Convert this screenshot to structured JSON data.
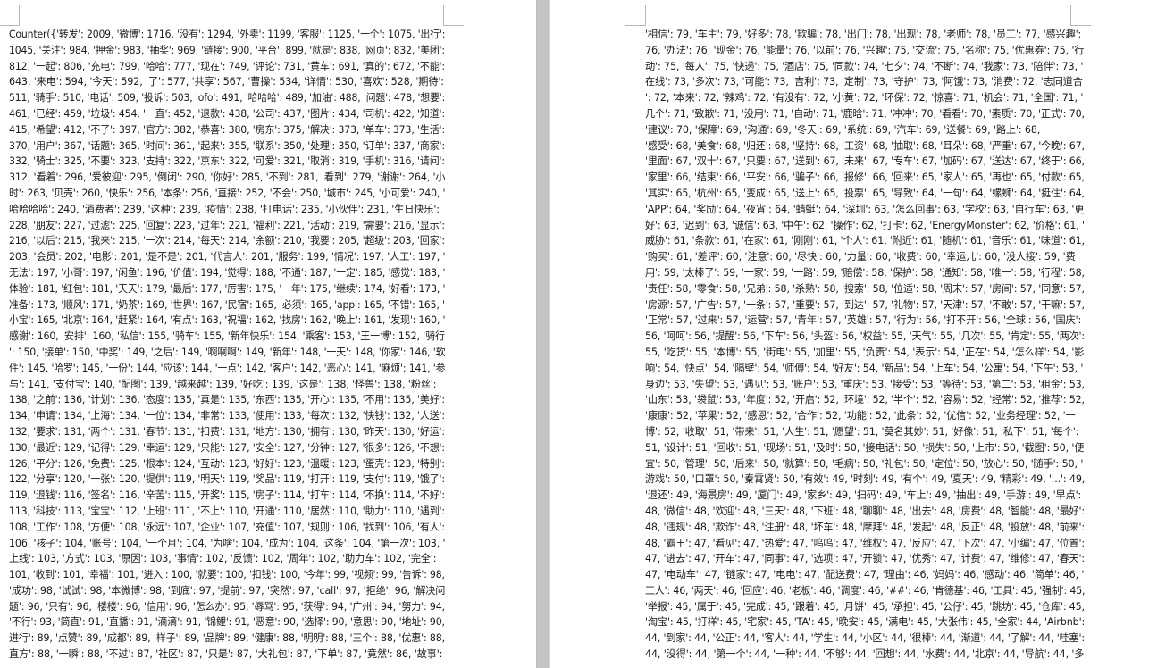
{
  "pages": {
    "left": {
      "lines": [
        "Counter({'转发': 2009, '微博': 1716, '没有': 1294, '外卖': 1199, '客服': 1125, '一个': 1075, '出行':",
        "1045, '关注': 984, '押金': 983, '抽奖': 969, '链接': 900, '平台': 899, '就是': 838, '网页': 832, '美团':",
        "812, '一起': 806, '充电': 799, '哈哈': 777, '现在': 749, '评论': 731, '黄车': 691, '真的': 672, '不能':",
        "643, '来电': 594, '今天': 592, '了': 577, '共享': 567, '曹操': 534, '详情': 530, '喜欢': 528, '期待':",
        "511, '骑手': 510, '电话': 509, '投诉': 503, 'ofo': 491, '哈哈哈': 489, '加油': 488, '问题': 478, '想要':",
        "461, '已经': 459, '垃圾': 454, '一直': 452, '退款': 438, '公司': 437, '图片': 434, '司机': 422, '知道':",
        "415, '希望': 412, '不了': 397, '官方': 382, '恭喜': 380, '房东': 375, '解决': 373, '单车': 373, '生活':",
        "370, '用户': 367, '话题': 365, '时间': 361, '起来': 355, '联系': 350, '处理': 350, '订单': 337, '商家':",
        "332, '骑士': 325, '不要': 323, '支持': 322, '京东': 322, '可爱': 321, '取消': 319, '手机': 316, '请问':",
        "312, '看着': 296, '爱彼迎': 295, '倒闭': 290, '你好': 285, '不到': 281, '看到': 279, '谢谢': 264, '小",
        "时': 263, '贝壳': 260, '快乐': 256, '本条': 256, '直接': 252, '不会': 250, '城市': 245, '小可爱': 240, '",
        "哈哈哈哈': 240, '消费者': 239, '这种': 239, '疫情': 238, '打电话': 235, '小伙伴': 231, '生日快乐':",
        "228, '朋友': 227, '过滤': 225, '回复': 223, '过年': 221, '福利': 221, '活动': 219, '需要': 216, '显示':",
        "216, '以后': 215, '我来': 215, '一次': 214, '每天': 214, '余额': 210, '我要': 205, '超级': 203, '回家':",
        "203, '会员': 202, '电影': 201, '是不是': 201, '代言人': 201, '服务': 199, '情况': 197, '人工': 197, '",
        "无法': 197, '小哥': 197, '闲鱼': 196, '价值': 194, '觉得': 188, '不通': 187, '一定': 185, '感觉': 183, '",
        "体验': 181, '红包': 181, '天天': 179, '最后': 177, '厉害': 175, '一年': 175, '继续': 174, '好看': 173, '",
        "准备': 173, '顺风': 171, '奶茶': 169, '世界': 167, '民宿': 165, '必须': 165, 'app': 165, '不错': 165, '",
        "小宝': 165, '北京': 164, '赶紧': 164, '有点': 163, '祝福': 162, '找房': 162, '晚上': 161, '发现': 160, '",
        "感谢': 160, '安排': 160, '私信': 155, '骑车': 155, '新年快乐': 154, '乘客': 153, '王一博': 152, '骑行",
        "': 150, '接单': 150, '中奖': 149, '之后': 149, '啊啊啊': 149, '新年': 148, '一天': 148, '你家': 146, '软",
        "件': 145, '哈罗': 145, '一份': 144, '应该': 144, '一点': 142, '客户': 142, '恶心': 141, '麻烦': 141, '参",
        "与': 141, '支付宝': 140, '配图': 139, '越来越': 139, '好吃': 139, '这是': 138, '怪兽': 138, '粉丝':",
        "138, '之前': 136, '计划': 136, '态度': 135, '真是': 135, '东西': 135, '开心': 135, '不用': 135, '美好':",
        "134, '申请': 134, '上海': 134, '一位': 134, '非常': 133, '使用': 133, '每次': 132, '快钱': 132, '人送':",
        "132, '要求': 131, '两个': 131, '春节': 131, '扣费': 131, '地方': 130, '拥有': 130, '昨天': 130, '好运':",
        "130, '最近': 129, '记得': 129, '幸运': 129, '只能': 127, '安全': 127, '分钟': 127, '很多': 126, '不想':",
        "126, '平分': 126, '免费': 125, '根本': 124, '互动': 123, '好好': 123, '温暖': 123, '蛋壳': 123, '特别':",
        "122, '分享': 120, '一张': 120, '提供': 119, '明天': 119, '奖品': 119, '打开': 119, '支付': 119, '饿了':",
        "119, '退钱': 116, '签名': 116, '辛苦': 115, '开奖': 115, '房子': 114, '打车': 114, '不换': 114, '不好':",
        "113, '科技': 113, '宝宝': 112, '上班': 111, '不上': 110, '开通': 110, '居然': 110, '助力': 110, '遇到':",
        "108, '工作': 108, '方便': 108, '永远': 107, '企业': 107, '充值': 107, '规则': 106, '找到': 106, '有人':",
        "106, '孩子': 104, '账号': 104, '一个月': 104, '为啥': 104, '成为': 104, '这条': 104, '第一次': 103, '",
        "上线': 103, '方式': 103, '原因': 103, '事情': 102, '反馈': 102, '周年': 102, '助力车': 102, '完全':",
        "101, '收到': 101, '幸福': 101, '进入': 100, '就要': 100, '扣钱': 100, '今年': 99, '视频': 99, '告诉': 98,",
        "'成功': 98, '试试': 98, '本微博': 98, '到底': 97, '提前': 97, '突然': 97, 'call': 97, '拒绝': 96, '解决问",
        "题': 96, '只有': 96, '楼楼': 96, '信用': 96, '怎么办': 95, '辱骂': 95, '获得': 94, '广州': 94, '努力': 94,",
        "'不行': 93, '简直': 91, '直播': 91, '滴滴': 91, '锦鲤': 91, '恶意': 90, '选择': 90, '意思': 90, '地址': 90,",
        "进行': 89, '点赞': 89, '成都': 89, '样子': 89, '品牌': 89, '健康': 88, '明明': 88, '三个': 88, '优惠': 88,",
        "直方': 88, '一瞬': 88, '不过': 87, '社区': 87, '只是': 87, '大礼包': 87, '下单': 87, '竟然': 86, '故事':"
      ]
    },
    "right": {
      "lines": [
        "'相信': 79, '车主': 79, '好多': 78, '欺骗': 78, '出门': 78, '出现': 78, '老师': 78, '员工': 77, '感兴趣':",
        "76, '办法': 76, '现金': 76, '能量': 76, '以前': 76, '兴趣': 75, '交流': 75, '名称': 75, '优惠券': 75, '行",
        "动': 75, '每人': 75, '快递': 75, '酒店': 75, '同款': 74, '七夕': 74, '不断': 74, '我家': 73, '陪伴': 73, '",
        "在线': 73, '多次': 73, '可能': 73, '吉利': 73, '定制': 73, '守护': 73, '阿饿': 73, '消费': 72, '志同道合",
        "': 72, '本来': 72, '辣鸡': 72, '有没有': 72, '小黄': 72, '环保': 72, '惊喜': 71, '机会': 71, '全国': 71, '",
        "几个': 71, '致歉': 71, '没用': 71, '自动': 71, '鹿晗': 71, '冲冲': 70, '看看': 70, '素质': 70, '正式': 70,",
        "'建议': 70, '保障': 69, '沟通': 69, '冬天': 69, '系统': 69, '汽车': 69, '送餐': 69, '路上': 68,",
        "'感受': 68, '美食': 68, '归还': 68, '坚持': 68, '工资': 68, '抽取': 68, '耳朵': 68, '严重': 67, '今晚': 67,",
        "'里面': 67, '双十': 67, '只要': 67, '送到': 67, '未来': 67, '专车': 67, '加码': 67, '送达': 67, '终于': 66,",
        "'家里': 66, '结束': 66, '平安': 66, '骗子': 66, '报修': 66, '回来': 65, '家人': 65, '再也': 65, '付款': 65,",
        "'其实': 65, '杭州': 65, '变成': 65, '送上': 65, '投票': 65, '导致': 64, '一句': 64, '螺蛳': 64, '挺住': 64,",
        "'APP': 64, '奖励': 64, '夜宵': 64, '蜻蜓': 64, '深圳': 63, '怎么回事': 63, '学校': 63, '自行车': 63, '更",
        "好': 63, '迟到': 63, '诚信': 63, '中午': 62, '操作': 62, '打卡': 62, 'EnergyMonster': 62, '价格': 61, '",
        "威胁': 61, '条款': 61, '在家': 61, '刚刚': 61, '个人': 61, '附近': 61, '随机': 61, '音乐': 61, '味道': 61,",
        "'购买': 61, '差评': 60, '注意': 60, '尽快': 60, '力量': 60, '收费': 60, '幸运儿': 60, '没人接': 59, '费",
        "用': 59, '太棒了': 59, '一家': 59, '一路': 59, '赔偿': 58, '保护': 58, '通知': 58, '唯一': 58, '行程': 58,",
        "'责任': 58, '零食': 58, '兄弟': 58, '杀熟': 58, '搜索': 58, '位适': 58, '周末': 57, '房间': 57, '同意': 57,",
        "'房源': 57, '广告': 57, '一条': 57, '重要': 57, '到达': 57, '礼物': 57, '天津': 57, '不敢': 57, '干嘛': 57,",
        "'正常': 57, '过来': 57, '运营': 57, '青年': 57, '英雄': 57, '行为': 56, '打不开': 56, '全球': 56, '国庆':",
        "56, '呵呵': 56, '提醒': 56, '下车': 56, '头盔': 56, '权益': 55, '天气': 55, '几次': 55, '肯定': 55, '两次':",
        "55, '吃货': 55, '本博': 55, '街电': 55, '加里': 55, '负责': 54, '表示': 54, '正在': 54, '怎么样': 54, '影",
        "响': 54, '快点': 54, '隔壁': 54, '师傅': 54, '好友': 54, '新品': 54, '上车': 54, '公寓': 54, '下午': 53, '",
        "身边': 53, '失望': 53, '遇见': 53, '账户': 53, '重庆': 53, '接受': 53, '等待': 53, '第二': 53, '租金': 53,",
        "'山东': 53, '袋鼠': 53, '年度': 52, '开启': 52, '环境': 52, '半个': 52, '容易': 52, '经常': 52, '推荐': 52,",
        "'康康': 52, '苹果': 52, '感恩': 52, '合作': 52, '功能': 52, '此条': 52, '优信': 52, '业务经理': 52, '一",
        "博': 52, '收取': 51, '带来': 51, '人生': 51, '愿望': 51, '莫名其妙': 51, '好像': 51, '私下': 51, '每个':",
        "51, '设计': 51, '回收': 51, '现场': 51, '及时': 50, '接电话': 50, '损失': 50, '上市': 50, '截图': 50, '便",
        "宜': 50, '管理': 50, '后来': 50, '就算': 50, '毛病': 50, '礼包': 50, '定位': 50, '放心': 50, '随手': 50, '",
        "游戏': 50, '口罩': 50, '秦霄贤': 50, '有效': 49, '时刻': 49, '有个': 49, '夏天': 49, '精彩': 49, '...': 49,",
        "'退还': 49, '海景房': 49, '厦门': 49, '家乡': 49, '扫码': 49, '车上': 49, '抽出': 49, '手游': 49, '早点':",
        "48, '微信': 48, '欢迎': 48, '三天': 48, '下班': 48, '聊聊': 48, '出去': 48, '房费': 48, '智能': 48, '最好':",
        "48, '违规': 48, '欺诈': 48, '注册': 48, '坏车': 48, '摩拜': 48, '发起': 48, '反正': 48, '投放': 48, '前来':",
        "48, '霸王': 47, '看见': 47, '热爱': 47, '呜呜': 47, '维权': 47, '反应': 47, '下次': 47, '小编': 47, '位置':",
        "47, '进去': 47, '开车': 47, '同事': 47, '选项': 47, '开锁': 47, '优秀': 47, '计费': 47, '维修': 47, '春天':",
        "47, '电动车': 47, '链家': 47, '电电': 47, '配送费': 47, '理由': 46, '妈妈': 46, '感动': 46, '简单': 46, '",
        "工人': 46, '两天': 46, '回应': 46, '老板': 46, '调度': 46, '##': 46, '肯德基': 46, '工具': 45, '强制': 45,",
        "'举报': 45, '属于': 45, '完成': 45, '跟着': 45, '月饼': 45, '承担': 45, '公仔': 45, '跳坊': 45, '仓库': 45,",
        "'淘宝': 45, '打样': 45, '宅家': 45, 'TA': 45, '晚安': 45, '满电': 45, '大张伟': 45, '全家': 44, 'Airbnb':",
        "44, '到家': 44, '公正': 44, '客人': 44, '学生': 44, '小区': 44, '很棒': 44, '渐道': 44, '了解': 44, '哇塞':",
        "44, '没得': 44, '第一个': 44, '一种': 44, '不够': 44, '回想': 44, '水费': 44, '北京': 44, '导航': 44, '多"
      ]
    }
  }
}
